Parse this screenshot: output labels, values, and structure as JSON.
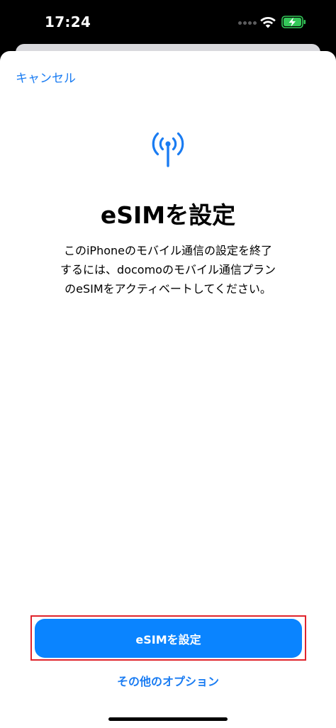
{
  "status_bar": {
    "time": "17:24",
    "icons": [
      "cellular-dots-icon",
      "wifi-icon",
      "battery-charging-icon"
    ]
  },
  "colors": {
    "accent": "#1a7cf2",
    "primary_button": "#0a84ff",
    "highlight": "#e0242c",
    "battery_fill": "#34c759"
  },
  "sheet": {
    "cancel_label": "キャンセル",
    "icon": "antenna-signal-icon",
    "title": "eSIMを設定",
    "description_lines": [
      "このiPhoneのモバイル通信の設定を終了",
      "するには、docomoのモバイル通信プラン",
      "のeSIMをアクティベートしてください。"
    ],
    "primary_button_label": "eSIMを設定",
    "secondary_button_label": "その他のオプション"
  }
}
